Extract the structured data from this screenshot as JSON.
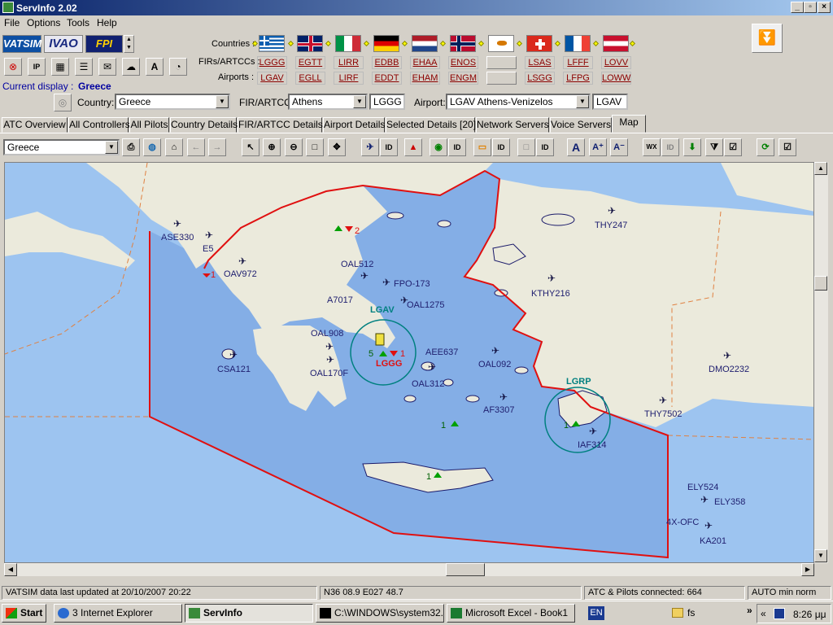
{
  "window": {
    "title": "ServInfo 2.02"
  },
  "menu": [
    "File",
    "Options",
    "Tools",
    "Help"
  ],
  "networks": {
    "vatsim": "VATSIM",
    "ivao": "IVAO",
    "fpi": "FPI"
  },
  "labels": {
    "countries": "Countries :",
    "firs": "FIRs/ARTCCs :",
    "airports": "Airports :",
    "current_display": "Current display :",
    "current_display_value": "Greece",
    "country": "Country:",
    "fir": "FIR/ARTCC:",
    "airport": "Airport:"
  },
  "fir_codes": [
    "LGGG",
    "EGTT",
    "LIRR",
    "EDBB",
    "EHAA",
    "ENOS",
    "",
    "LSAS",
    "LFFF",
    "LOVV"
  ],
  "airport_codes": [
    "LGAV",
    "EGLL",
    "LIRF",
    "EDDT",
    "EHAM",
    "ENGM",
    "",
    "LSGG",
    "LFPG",
    "LOWW"
  ],
  "selectors": {
    "country": "Greece",
    "fir": "Athens",
    "fir_code": "LGGG",
    "airport": "LGAV Athens-Venizelos",
    "airport_code": "LGAV"
  },
  "tabs": [
    "ATC Overview",
    "All Controllers",
    "All Pilots",
    "Country Details",
    "FIR/ARTCC Details",
    "Airport Details",
    "Selected Details [20]",
    "Network Servers",
    "Voice Servers",
    "Map"
  ],
  "map_toolbar": {
    "region": "Greece",
    "id": "ID",
    "wx": "WX",
    "font": "A"
  },
  "map": {
    "aircraft": [
      "ASE330",
      "E5",
      "OAV972",
      "OAL512",
      "FPO-173",
      "A7017",
      "OAL1275",
      "OAL908",
      "AEE637",
      "CSA121",
      "OAL170F",
      "OAL092",
      "OAL312",
      "AF3307",
      "IAF314",
      "THY247",
      "KTHY216",
      "DMO2232",
      "THY7502",
      "ELY524",
      "ELY358",
      "4X-OFC",
      "KA201"
    ],
    "airport_labels": [
      "LGAV",
      "LGGG",
      "LGRP"
    ],
    "counts": [
      "2",
      "1",
      "1",
      "1",
      "1",
      "5",
      "1"
    ]
  },
  "status": {
    "updated": "VATSIM data last updated at 20/10/2007 20:22",
    "coords": "N36 08.9   E027 48.7",
    "connected": "ATC & Pilots connected: 664",
    "mode": "AUTO min norm"
  },
  "taskbar": {
    "start": "Start",
    "tasks": [
      "3 Internet Explorer",
      "ServInfo",
      "C:\\WINDOWS\\system32...",
      "Microsoft Excel - Book1"
    ],
    "lang": "EN",
    "folder": "fs",
    "clock": "8:26 μμ"
  }
}
